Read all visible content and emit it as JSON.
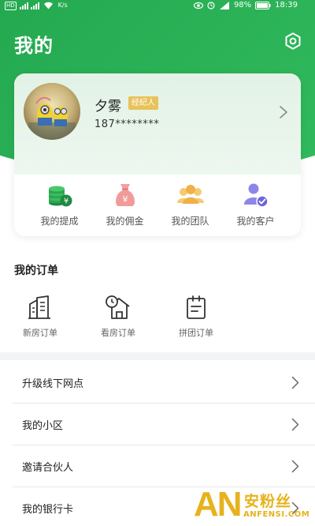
{
  "status_bar": {
    "left_badge": "HD",
    "network": "K/s",
    "battery": "98%",
    "time": "18:39"
  },
  "header": {
    "title": "我的",
    "settings_icon": "settings-hexagon-icon"
  },
  "profile": {
    "name": "夕雾",
    "role_badge": "经纪人",
    "phone": "187********"
  },
  "quick_actions": [
    {
      "label": "我的提成",
      "icon": "coins-stack-icon",
      "color": "#2aa54f"
    },
    {
      "label": "我的佣金",
      "icon": "money-bag-icon",
      "color": "#f08c8c"
    },
    {
      "label": "我的团队",
      "icon": "team-icon",
      "color": "#f0b84a"
    },
    {
      "label": "我的客户",
      "icon": "customer-check-icon",
      "color": "#8d86e8"
    }
  ],
  "orders": {
    "title": "我的订单",
    "items": [
      {
        "label": "新房订单",
        "icon": "building-icon"
      },
      {
        "label": "看房订单",
        "icon": "house-clock-icon"
      },
      {
        "label": "拼团订单",
        "icon": "clipboard-icon"
      }
    ]
  },
  "menu": [
    {
      "label": "升级线下网点"
    },
    {
      "label": "我的小区"
    },
    {
      "label": "邀请合伙人"
    },
    {
      "label": "我的银行卡"
    }
  ],
  "watermark": {
    "logo": "AN",
    "cn": "安粉丝",
    "en": "ANFENSI.COM"
  },
  "colors": {
    "brand_green": "#2bb257",
    "badge_gold": "#e8c25a"
  }
}
